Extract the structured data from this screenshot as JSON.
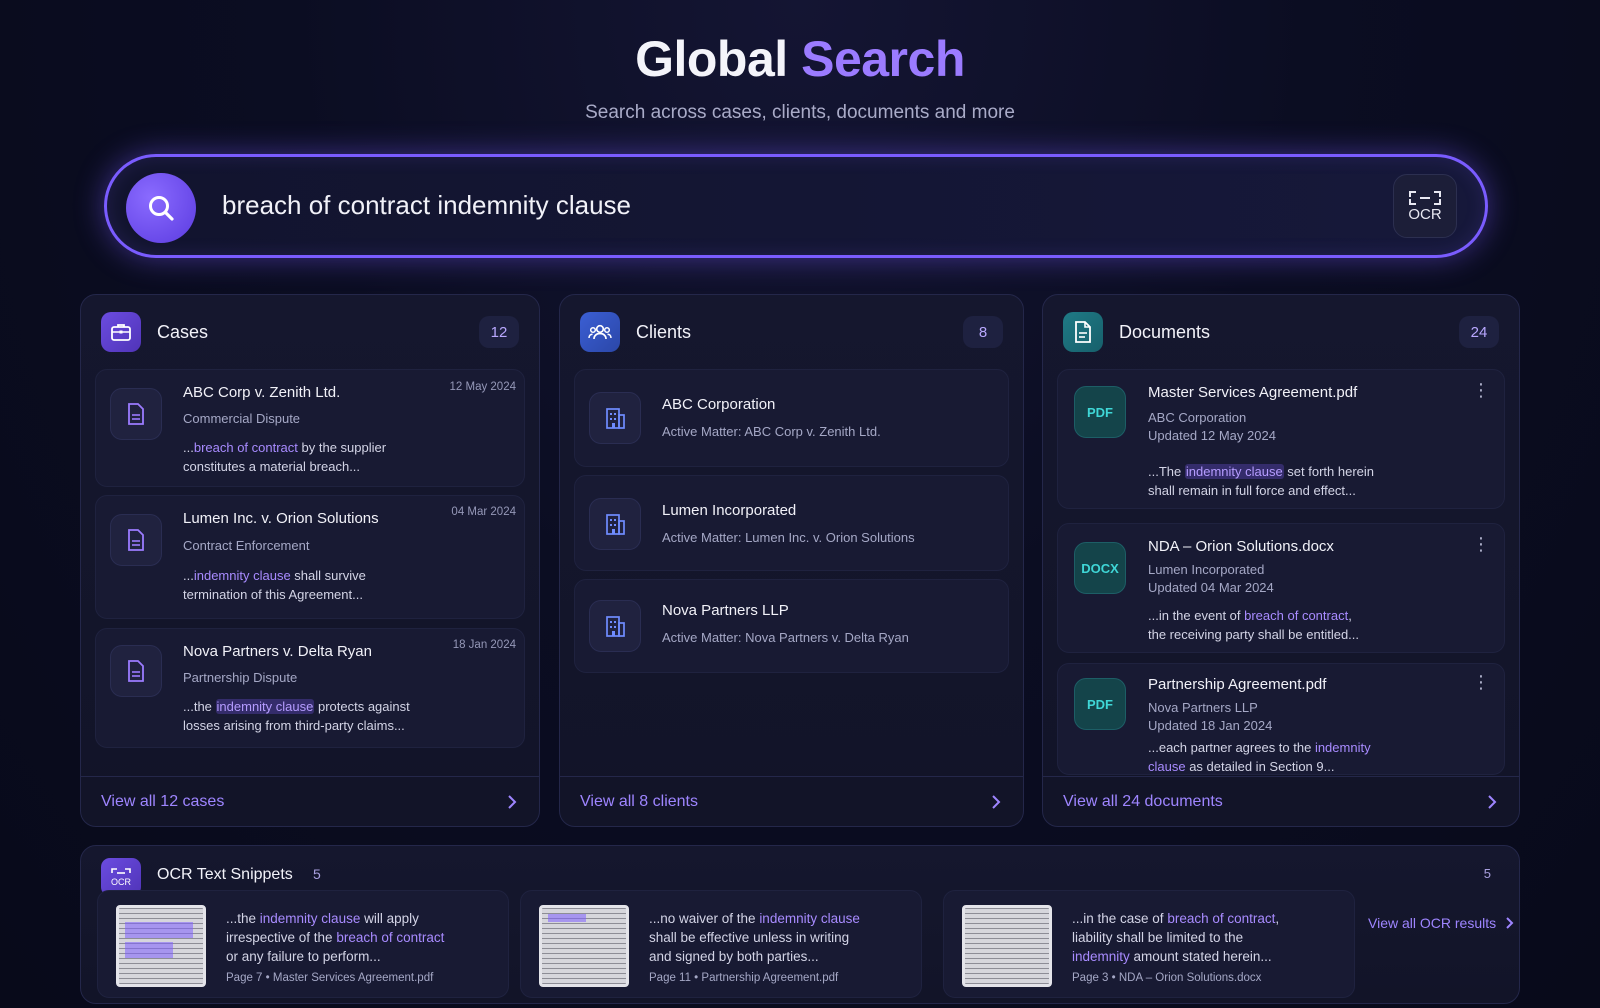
{
  "header": {
    "title_main": "Global",
    "title_accent": "Search",
    "subtitle": "Search across cases, clients, documents and more"
  },
  "search": {
    "query": "breach of contract indemnity clause",
    "ocr_label": "OCR"
  },
  "colors": {
    "accent": "#7a5cff",
    "highlight": "#a88bff",
    "teal": "#3fd6d6",
    "background": "#0b0d22"
  },
  "cases": {
    "title": "Cases",
    "count": "12",
    "view_all": "View all 12 cases",
    "items": [
      {
        "name": "ABC Corp v. Zenith Ltd.",
        "type": "Commercial Dispute",
        "date": "12 May 2024",
        "pre": "...",
        "hl": "breach of contract",
        "post": " by the supplier",
        "line2": "constitutes a material breach..."
      },
      {
        "name": "Lumen Inc. v. Orion Solutions",
        "type": "Contract Enforcement",
        "date": "04 Mar 2024",
        "pre": "...",
        "hl": "indemnity clause",
        "post": " shall survive",
        "line2": "termination of this Agreement..."
      },
      {
        "name": "Nova Partners v. Delta Ryan",
        "type": "Partnership Dispute",
        "date": "18 Jan 2024",
        "pre": "...the ",
        "hl": "indemnity clause",
        "post": " protects against",
        "line2": "losses arising from third-party claims..."
      }
    ]
  },
  "clients": {
    "title": "Clients",
    "count": "8",
    "view_all": "View all 8 clients",
    "items": [
      {
        "name": "ABC Corporation",
        "matter": "Active Matter: ABC Corp v. Zenith Ltd."
      },
      {
        "name": "Lumen Incorporated",
        "matter": "Active Matter: Lumen Inc. v. Orion Solutions"
      },
      {
        "name": "Nova Partners LLP",
        "matter": "Active Matter: Nova Partners v. Delta Ryan"
      }
    ]
  },
  "documents": {
    "title": "Documents",
    "count": "24",
    "view_all": "View all 24 documents",
    "items": [
      {
        "badge": "PDF",
        "name": "Master Services Agreement.pdf",
        "client": "ABC Corporation",
        "updated": "Updated 12 May 2024",
        "pre": "...The ",
        "hl": "indemnity clause",
        "post": " set forth herein",
        "line2": "shall remain in full force and effect..."
      },
      {
        "badge": "DOCX",
        "name": "NDA – Orion Solutions.docx",
        "client": "Lumen Incorporated",
        "updated": "Updated 04 Mar 2024",
        "pre": "...in the event of ",
        "hl": "breach of contract",
        "post": ",",
        "line2": "the receiving party shall be entitled..."
      },
      {
        "badge": "PDF",
        "name": "Partnership Agreement.pdf",
        "client": "Nova Partners LLP",
        "updated": "Updated 18 Jan 2024",
        "pre": "...each partner agrees to the ",
        "hl": "indemnity",
        "hl2": "clause",
        "post": " as detailed in Section 9..."
      }
    ]
  },
  "ocr": {
    "title": "OCR Text Snippets",
    "count": "5",
    "count_right": "5",
    "view_all": "View all OCR results",
    "icon_label": "OCR",
    "items": [
      {
        "l1_pre": "...the ",
        "l1_hl": "indemnity clause",
        "l1_post": " will apply",
        "l2_pre": "irrespective of the ",
        "l2_hl": "breach of contract",
        "l3": "or any failure to perform...",
        "meta": "Page 7 • Master Services Agreement.pdf"
      },
      {
        "l1_pre": "...no waiver of the ",
        "l1_hl": "indemnity clause",
        "l2": "shall be effective unless in writing",
        "l3": "and signed by both parties...",
        "meta": "Page 11 • Partnership Agreement.pdf"
      },
      {
        "l1_pre": "...in the case of ",
        "l1_hl": "breach of contract",
        "l1_post": ",",
        "l2": "liability shall be limited to the",
        "l3_hl": "indemnity",
        "l3_post": " amount stated herein...",
        "meta": "Page 3 • NDA – Orion Solutions.docx"
      }
    ]
  }
}
